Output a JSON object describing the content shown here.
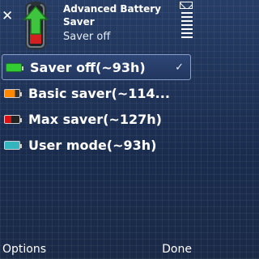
{
  "header": {
    "title": "Advanced Battery Saver",
    "subtitle": "Saver off",
    "close_glyph": "✕",
    "app_icon": "battery-upload-icon"
  },
  "status": {
    "message_icon": "envelope-icon",
    "signal_icon": "signal-bars-icon"
  },
  "menu": {
    "items": [
      {
        "label": "Saver off(~93h)",
        "battery_color": "#33cc33",
        "icon": "battery-green-icon",
        "selected": true
      },
      {
        "label": "Basic saver(~114...",
        "battery_color": "#ff8800",
        "icon": "battery-orange-icon",
        "selected": false
      },
      {
        "label": "Max saver(~127h)",
        "battery_color": "#dd1111",
        "icon": "battery-red-icon",
        "selected": false
      },
      {
        "label": "User mode(~93h)",
        "battery_color": "#33b5c0",
        "icon": "battery-teal-icon",
        "selected": false
      }
    ],
    "check_glyph": "✓"
  },
  "softkeys": {
    "left": "Options",
    "right": "Done"
  }
}
